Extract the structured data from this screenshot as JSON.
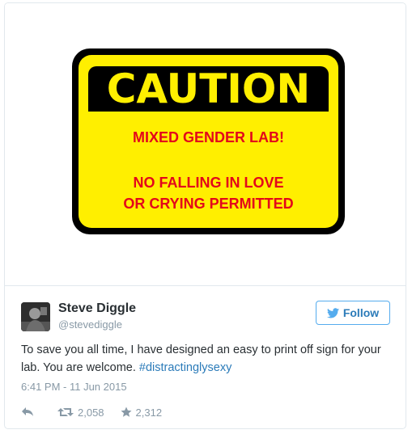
{
  "media": {
    "sign": {
      "title": "CAUTION",
      "line1": "MIXED GENDER LAB!",
      "line2": "NO FALLING IN LOVE",
      "line3": "OR CRYING PERMITTED",
      "colors": {
        "background": "#ffef00",
        "band": "#000000",
        "text": "#e3061b"
      }
    }
  },
  "author": {
    "name": "Steve Diggle",
    "handle": "@stevediggle",
    "avatar_icon": "avatar-photo"
  },
  "follow": {
    "label": "Follow",
    "icon": "twitter-bird-icon"
  },
  "tweet": {
    "text": "To save you all time, I have designed an easy to print off sign for your lab. You are welcome. ",
    "hashtag": "#distractinglysexy"
  },
  "timestamp": "6:41 PM - 11 Jun 2015",
  "actions": {
    "retweets": "2,058",
    "favorites": "2,312"
  },
  "colors": {
    "link": "#2b7bb9",
    "secondary_text": "#8899a6",
    "border": "#e1e8ed"
  }
}
